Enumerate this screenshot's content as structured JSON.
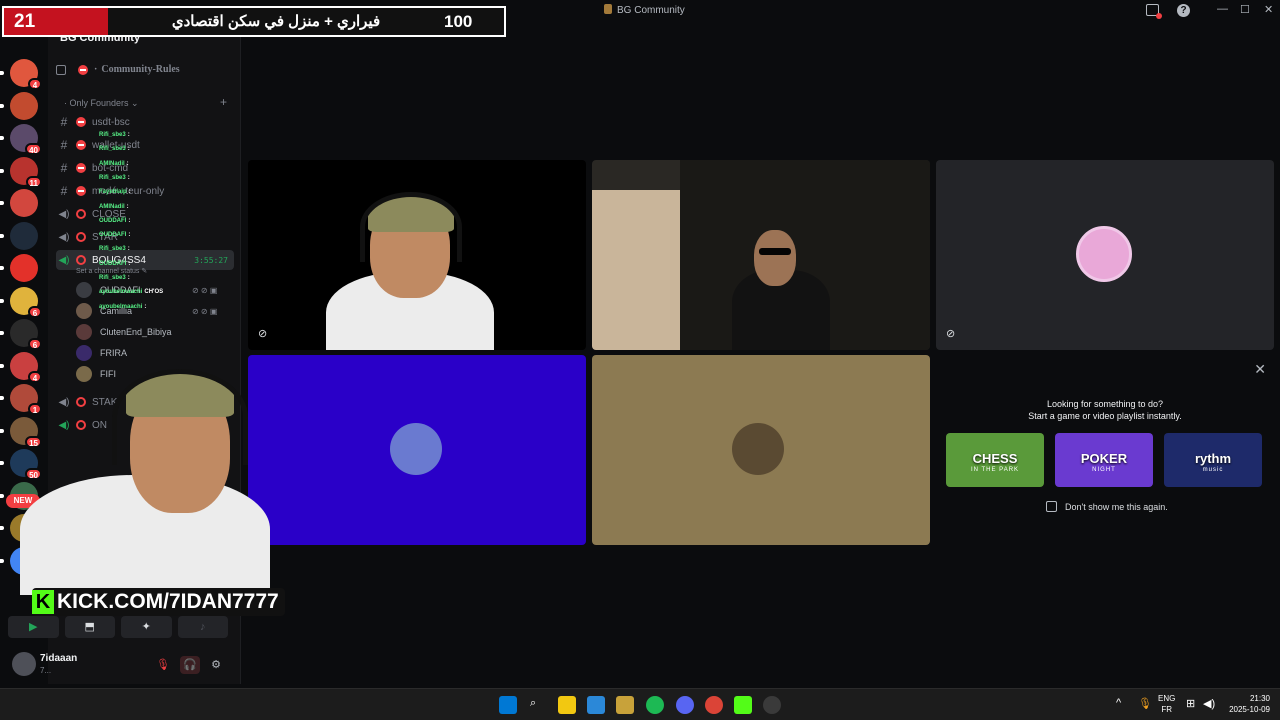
{
  "window": {
    "title": "BG Community",
    "minimize": "—",
    "maximize": "☐",
    "close": "✕",
    "help": "?"
  },
  "banner": {
    "count": "21",
    "headline": "فيراري + منزل في سكن اقتصادي",
    "score": "100"
  },
  "servers": [
    {
      "badge": "4",
      "color": "#e0573e"
    },
    {
      "badge": "",
      "color": "#c24b2f"
    },
    {
      "badge": "40",
      "color": "#5b4a6a"
    },
    {
      "badge": "11",
      "color": "#b8332e"
    },
    {
      "badge": "",
      "color": "#d2473e"
    },
    {
      "badge": "",
      "color": "#1f2b3a"
    },
    {
      "badge": "",
      "color": "#e3312a"
    },
    {
      "badge": "6",
      "color": "#e0b33c"
    },
    {
      "badge": "6",
      "color": "#2a2a2a"
    },
    {
      "badge": "4",
      "color": "#c94040"
    },
    {
      "badge": "1",
      "color": "#b04a3a"
    },
    {
      "badge": "15",
      "color": "#7a5a3a"
    },
    {
      "badge": "50",
      "color": "#1e3a5a"
    },
    {
      "badge": "4",
      "color": "#3a6a4a"
    },
    {
      "badge": "",
      "color": "#9a7a2a"
    },
    {
      "badge": "",
      "color": "#4285f4"
    }
  ],
  "new_badge": "NEW",
  "sidebar": {
    "server_name": "BG Community",
    "rules_channel": "Community-Rules",
    "category": "Only Founders",
    "category_add": "+",
    "channels": [
      {
        "name": "usdt-bsc",
        "type": "text"
      },
      {
        "name": "wallet-usdt",
        "type": "text"
      },
      {
        "name": "bot-cmd",
        "type": "text"
      },
      {
        "name": "modé...teur-only",
        "type": "text"
      },
      {
        "name": "CLOSE",
        "type": "voice"
      },
      {
        "name": "STAR",
        "type": "voice"
      },
      {
        "name": "BOUG4SS4",
        "type": "voice-active",
        "timer": "3:55:27"
      }
    ],
    "status_line": "Set a channel status",
    "voice_users": [
      {
        "name": "OUDDAFI",
        "color": "#3a3c42"
      },
      {
        "name": "Camillia",
        "color": "#6e5a4a"
      },
      {
        "name": "ClutenEnd_Bibiya",
        "color": "#5a3a3a"
      },
      {
        "name": "FRIRA",
        "color": "#3a2a6a"
      },
      {
        "name": "FIFI",
        "color": "#7a6a4a"
      }
    ],
    "lower_channels": [
      {
        "name": "STAK"
      },
      {
        "name": "ON"
      }
    ]
  },
  "chat_overlay": [
    {
      "user": "Rifi_sbe3",
      "msg": ":"
    },
    {
      "user": "Rifi_sbe3",
      "msg": ":"
    },
    {
      "user": "AMINadil",
      "msg": ":"
    },
    {
      "user": "Rifi_sbe3",
      "msg": ":"
    },
    {
      "user": "Fayeblaip",
      "msg": ":"
    },
    {
      "user": "AMINadil",
      "msg": ":"
    },
    {
      "user": "OUDDAFI",
      "msg": ":"
    },
    {
      "user": "OUDDAFI",
      "msg": ":"
    },
    {
      "user": "Rifi_sbe3",
      "msg": ":"
    },
    {
      "user": "OUDDAFI",
      "msg": ":"
    },
    {
      "user": "Rifi_sbe3",
      "msg": ":"
    },
    {
      "user": "ayoubelmaachi",
      "msg": "CH'OS"
    },
    {
      "user": "ayoubelmaachi",
      "msg": ":"
    }
  ],
  "media_bar": {
    "camera": "▶",
    "screen": "⬒",
    "activity": "✦",
    "soundboard": "♪"
  },
  "user_panel": {
    "name": "7idaaan",
    "status": "7...",
    "mute_icon": "🎙",
    "deafen_icon": "🎧",
    "settings_icon": "⚙"
  },
  "activity": {
    "close": "✕",
    "line1": "Looking for something to do?",
    "line2": "Start a game or video playlist instantly.",
    "games": [
      {
        "title": "CHESS",
        "sub": "IN THE PARK",
        "color": "#5a9a3a"
      },
      {
        "title": "POKER",
        "sub": "NIGHT",
        "color": "#6a3ad0"
      },
      {
        "title": "rythm",
        "sub": "music",
        "color": "#1e2a6a"
      }
    ],
    "dont_show": "Don't show me this again."
  },
  "kick": {
    "logo": "K",
    "url": "KICK.COM/7IDAN7777"
  },
  "taskbar": {
    "lang1": "ENG",
    "lang2": "FR",
    "time": "21:30",
    "date": "2025-10-09",
    "tray_arrow": "^"
  }
}
